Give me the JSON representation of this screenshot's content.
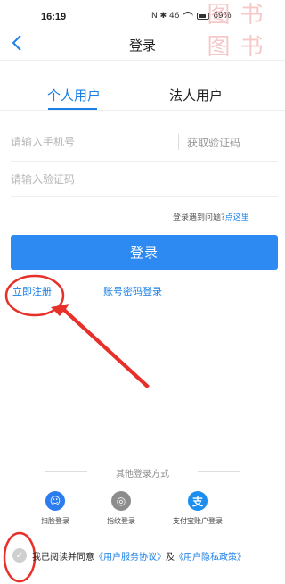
{
  "status_bar": {
    "time": "16:19",
    "icons_text": "N ✱ 46",
    "battery": "69%"
  },
  "watermark": [
    "图",
    "书",
    "图",
    "书"
  ],
  "nav": {
    "title": "登录"
  },
  "tabs": [
    {
      "label": "个人用户",
      "active": true
    },
    {
      "label": "法人用户",
      "active": false
    }
  ],
  "form": {
    "phone_placeholder": "请输入手机号",
    "get_code": "获取验证码",
    "code_placeholder": "请输入验证码",
    "help_prefix": "登录遇到问题?",
    "help_link": "点这里",
    "login_button": "登录"
  },
  "links": {
    "register": "立即注册",
    "password_login": "账号密码登录"
  },
  "other_login": {
    "title": "其他登录方式",
    "methods": [
      {
        "label": "扫脸登录",
        "icon": "face-scan-icon",
        "color": "#2c7cf0"
      },
      {
        "label": "指纹登录",
        "icon": "fingerprint-icon",
        "color": "#8c8c8c"
      },
      {
        "label": "支付宝账户登录",
        "icon": "alipay-icon",
        "color": "#1b8ef0"
      }
    ]
  },
  "agreement": {
    "prefix": "我已阅读并同意",
    "service": "《用户服务协议》",
    "and": "及",
    "privacy": "《用户隐私政策》"
  },
  "colors": {
    "accent": "#1a7fe6",
    "button": "#2c8af2",
    "annotation": "#e8302a"
  }
}
